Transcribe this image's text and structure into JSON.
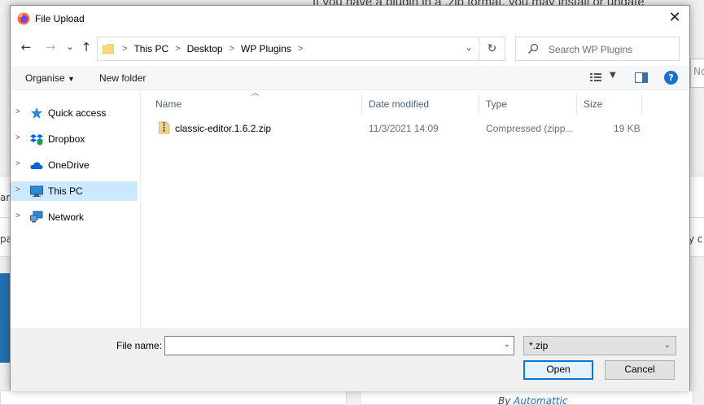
{
  "background": {
    "top_text": "If you have a plugin in a .zip format, you may install or update",
    "right_strip_text": "No",
    "left_word1": "ar",
    "left_word2": "pa",
    "right_word": "y c",
    "author_prefix": "By",
    "author_name": "Automattic"
  },
  "dialog": {
    "title": "File Upload",
    "close_label": "✕",
    "nav": {
      "back": "←",
      "forward": "→",
      "recent": "⌄",
      "up": "↑"
    },
    "address": {
      "crumbs": [
        "This PC",
        "Desktop",
        "WP Plugins"
      ],
      "separator": ">",
      "refresh": "↻"
    },
    "search": {
      "placeholder": "Search WP Plugins"
    },
    "toolbar": {
      "organise": "Organise",
      "new_folder": "New folder",
      "help": "?"
    },
    "navpane": {
      "items": [
        {
          "label": "Quick access",
          "icon": "star-icon"
        },
        {
          "label": "Dropbox",
          "icon": "dropbox-icon"
        },
        {
          "label": "OneDrive",
          "icon": "cloud-icon"
        },
        {
          "label": "This PC",
          "icon": "computer-icon",
          "selected": true
        },
        {
          "label": "Network",
          "icon": "network-icon"
        }
      ]
    },
    "files": {
      "columns": [
        "Name",
        "Date modified",
        "Type",
        "Size"
      ],
      "rows": [
        {
          "name": "classic-editor.1.6.2.zip",
          "date": "11/3/2021 14:09",
          "type": "Compressed (zipp...",
          "size": "19 KB"
        }
      ]
    },
    "bottom": {
      "file_name_label": "File name:",
      "file_name_value": "",
      "filter_value": "*.zip",
      "open_label": "Open",
      "cancel_label": "Cancel"
    }
  },
  "colors": {
    "selection": "#cce8ff",
    "accent": "#0078d7",
    "wp_blue": "#2271b1"
  }
}
